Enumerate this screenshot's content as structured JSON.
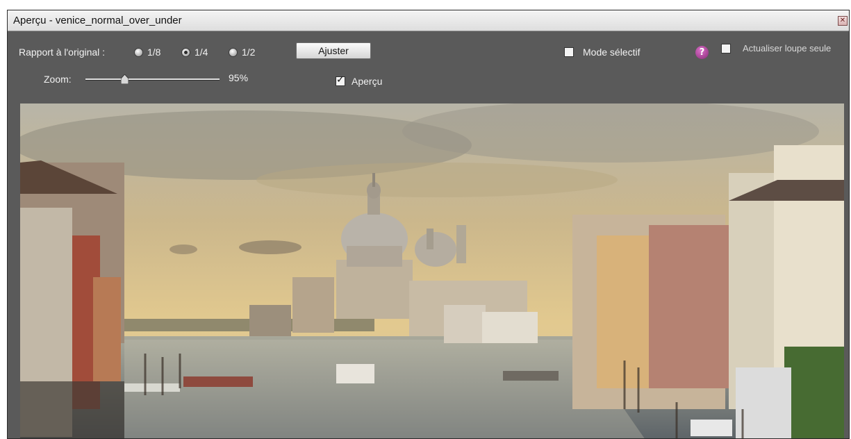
{
  "window": {
    "title": "Aperçu - venice_normal_over_under",
    "close_icon": "close-icon"
  },
  "ratio": {
    "label": "Rapport à l'original :",
    "options": [
      {
        "label": "1/8",
        "checked": false
      },
      {
        "label": "1/4",
        "checked": true
      },
      {
        "label": "1/2",
        "checked": false
      }
    ]
  },
  "adjust_button": "Ajuster",
  "selective_mode": {
    "label": "Mode sélectif",
    "checked": false
  },
  "help_icon": "?",
  "update_loupe": {
    "label": "Actualiser loupe seule",
    "checked": false
  },
  "zoom": {
    "label": "Zoom:",
    "value": "95%",
    "level": 0.95
  },
  "preview_toggle": {
    "label": "Aperçu",
    "checked": true
  },
  "colors": {
    "panel": "#5a5a5a",
    "titlebar": "#e8e8e8",
    "sky": "#cdb88a",
    "water": "#7f8890"
  }
}
